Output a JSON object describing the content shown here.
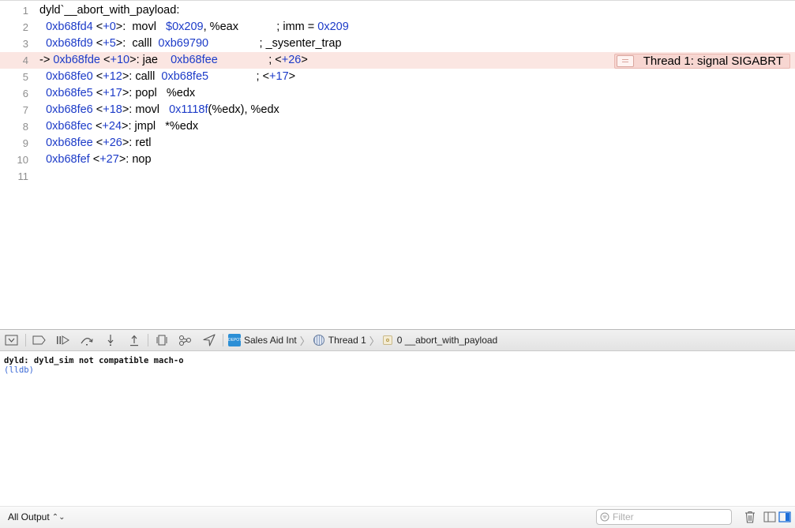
{
  "editor": {
    "lines": [
      {
        "n": "1",
        "tokens": [
          {
            "t": "text",
            "v": "dyld`__abort_with_payload:"
          }
        ]
      },
      {
        "n": "2",
        "tokens": [
          {
            "t": "text",
            "v": "  "
          },
          {
            "t": "addr",
            "v": "0xb68fd4"
          },
          {
            "t": "text",
            "v": " <"
          },
          {
            "t": "num",
            "v": "+0"
          },
          {
            "t": "text",
            "v": ">:  movl   "
          },
          {
            "t": "num",
            "v": "$0x209"
          },
          {
            "t": "text",
            "v": ", %eax            ; imm = "
          },
          {
            "t": "num",
            "v": "0x209"
          }
        ]
      },
      {
        "n": "3",
        "tokens": [
          {
            "t": "text",
            "v": "  "
          },
          {
            "t": "addr",
            "v": "0xb68fd9"
          },
          {
            "t": "text",
            "v": " <"
          },
          {
            "t": "num",
            "v": "+5"
          },
          {
            "t": "text",
            "v": ">:  calll  "
          },
          {
            "t": "num",
            "v": "0xb69790"
          },
          {
            "t": "text",
            "v": "                ; _sysenter_trap"
          }
        ]
      },
      {
        "n": "4",
        "current": true,
        "tokens": [
          {
            "t": "text",
            "v": "-> "
          },
          {
            "t": "addr",
            "v": "0xb68fde"
          },
          {
            "t": "text",
            "v": " <"
          },
          {
            "t": "num",
            "v": "+10"
          },
          {
            "t": "text",
            "v": ">: jae    "
          },
          {
            "t": "num",
            "v": "0xb68fee"
          },
          {
            "t": "text",
            "v": "                ; <"
          },
          {
            "t": "num",
            "v": "+26"
          },
          {
            "t": "text",
            "v": ">"
          }
        ]
      },
      {
        "n": "5",
        "tokens": [
          {
            "t": "text",
            "v": "  "
          },
          {
            "t": "addr",
            "v": "0xb68fe0"
          },
          {
            "t": "text",
            "v": " <"
          },
          {
            "t": "num",
            "v": "+12"
          },
          {
            "t": "text",
            "v": ">: calll  "
          },
          {
            "t": "num",
            "v": "0xb68fe5"
          },
          {
            "t": "text",
            "v": "               ; <"
          },
          {
            "t": "num",
            "v": "+17"
          },
          {
            "t": "text",
            "v": ">"
          }
        ]
      },
      {
        "n": "6",
        "tokens": [
          {
            "t": "text",
            "v": "  "
          },
          {
            "t": "addr",
            "v": "0xb68fe5"
          },
          {
            "t": "text",
            "v": " <"
          },
          {
            "t": "num",
            "v": "+17"
          },
          {
            "t": "text",
            "v": ">: popl   %edx"
          }
        ]
      },
      {
        "n": "7",
        "tokens": [
          {
            "t": "text",
            "v": "  "
          },
          {
            "t": "addr",
            "v": "0xb68fe6"
          },
          {
            "t": "text",
            "v": " <"
          },
          {
            "t": "num",
            "v": "+18"
          },
          {
            "t": "text",
            "v": ">: movl   "
          },
          {
            "t": "num",
            "v": "0x1118f"
          },
          {
            "t": "text",
            "v": "(%edx), %edx"
          }
        ]
      },
      {
        "n": "8",
        "tokens": [
          {
            "t": "text",
            "v": "  "
          },
          {
            "t": "addr",
            "v": "0xb68fec"
          },
          {
            "t": "text",
            "v": " <"
          },
          {
            "t": "num",
            "v": "+24"
          },
          {
            "t": "text",
            "v": ">: jmpl   *%edx"
          }
        ]
      },
      {
        "n": "9",
        "tokens": [
          {
            "t": "text",
            "v": "  "
          },
          {
            "t": "addr",
            "v": "0xb68fee"
          },
          {
            "t": "text",
            "v": " <"
          },
          {
            "t": "num",
            "v": "+26"
          },
          {
            "t": "text",
            "v": ">: retl"
          }
        ]
      },
      {
        "n": "10",
        "tokens": [
          {
            "t": "text",
            "v": "  "
          },
          {
            "t": "addr",
            "v": "0xb68fef"
          },
          {
            "t": "text",
            "v": " <"
          },
          {
            "t": "num",
            "v": "+27"
          },
          {
            "t": "text",
            "v": ">: nop"
          }
        ]
      },
      {
        "n": "11",
        "tokens": []
      }
    ],
    "annotation": "Thread 1: signal SIGABRT"
  },
  "debug_bar": {
    "buttons": [
      {
        "name": "hide-debug-area-button",
        "icon": "panel-down-icon"
      },
      {
        "name": "breakpoints-toggle-button",
        "icon": "breakpoint-icon"
      },
      {
        "name": "continue-button",
        "icon": "continue-icon"
      },
      {
        "name": "step-over-button",
        "icon": "step-over-icon"
      },
      {
        "name": "step-into-button",
        "icon": "step-into-icon"
      },
      {
        "name": "step-out-button",
        "icon": "step-out-icon"
      },
      {
        "name": "view-hierarchy-button",
        "icon": "view-hierarchy-icon"
      },
      {
        "name": "memory-graph-button",
        "icon": "memory-graph-icon"
      },
      {
        "name": "simulate-location-button",
        "icon": "location-arrow-icon"
      }
    ],
    "breadcrumb": {
      "app": "Sales Aid Int",
      "app_icon_text": "DEPOT",
      "thread": "Thread 1",
      "frame": "0 __abort_with_payload"
    }
  },
  "console": {
    "output_line": "dyld: dyld_sim not compatible mach-o",
    "prompt": "(lldb)"
  },
  "footer": {
    "output_selector": "All Output",
    "filter_placeholder": "Filter"
  },
  "colors": {
    "current_line_bg": "#fbe6e2",
    "annotation_bg": "#f7d6d1",
    "address_blue": "#1c3bc8",
    "prompt_blue": "#3b69d6",
    "pane_toggle_blue": "#1e6fd9"
  }
}
